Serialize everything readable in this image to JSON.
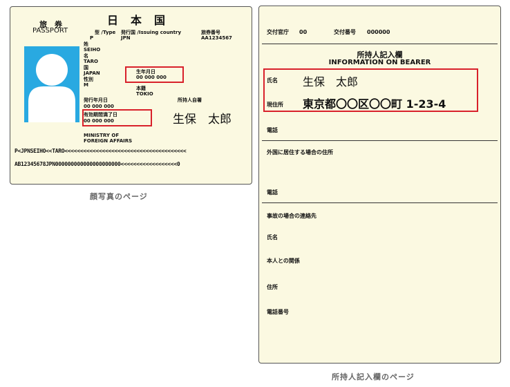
{
  "photo_page": {
    "country_title": "日　本　国",
    "passport_jp": "旅　券",
    "passport_en": "PASSPORT",
    "type_label": "型 /Type",
    "type_value": "P",
    "issuing_label": "発行国 /Issuing country",
    "issuing_value": "JPN",
    "passport_no_label": "旅券番号",
    "passport_no_value": "AA1234567",
    "surname_label": "姓",
    "surname_value": "SEIHO",
    "given_label": "名",
    "given_value": "TARO",
    "nationality_label": "国",
    "nationality_value": "JAPAN",
    "dob_label": "生年月日",
    "dob_value": "00 000 000",
    "sex_label": "性別",
    "sex_value": "M",
    "domicile_label": "本籍",
    "domicile_value": "TOKIO",
    "issue_date_label": "発行年月日",
    "issue_date_value": "00 000 000",
    "signature_label": "所持人自署",
    "expiry_label": "有効期間満了日",
    "expiry_value": "00 000 000",
    "signature_value": "生保　太郎",
    "authority_line1": "MINISTRY OF",
    "authority_line2": "FOREIGN AFFAIRS",
    "mrz_line1": "P<JPNSEIHO<<TARO<<<<<<<<<<<<<<<<<<<<<<<<<<<<<<<<<<<<<<<",
    "mrz_line2": "AB12345678JPN000000000000000000000<<<<<<<<<<<<<<<<<<0",
    "caption": "顔写真のページ"
  },
  "bearer_page": {
    "issuer_label": "交付官庁",
    "issuer_value": "00",
    "issue_no_label": "交付番号",
    "issue_no_value": "000000",
    "title_jp": "所持人記入欄",
    "title_en": "INFORMATION ON BEARER",
    "name_label": "氏名",
    "name_value": "生保　太郎",
    "address_label": "現住所",
    "address_value": "東京都〇〇区〇〇町 1-23-4",
    "phone_label": "電話",
    "foreign_address_label": "外国に居住する場合の住所",
    "phone2_label": "電話",
    "emergency_label": "事故の場合の連絡先",
    "emergency_name_label": "氏名",
    "relation_label": "本人との関係",
    "emergency_address_label": "住所",
    "emergency_phone_label": "電話番号",
    "caption": "所持人記入欄のページ"
  },
  "colors": {
    "card_bg": "#fbf9e1",
    "photo_bg": "#29a9e1",
    "highlight": "#d8202a"
  }
}
